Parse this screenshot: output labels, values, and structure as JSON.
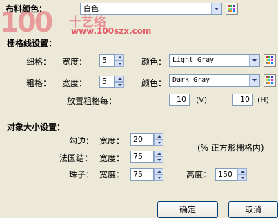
{
  "watermark": {
    "logo": "100",
    "cn": "十艺络",
    "url": "www.100szx.com"
  },
  "cloth_color": {
    "label": "布料颜色：",
    "value": "白色"
  },
  "grid": {
    "heading": "栅格线设置：",
    "fine": {
      "label": "细格：",
      "width_label": "宽度：",
      "width_value": "5",
      "color_label": "颜色：",
      "color_value": "Light Gray"
    },
    "coarse": {
      "label": "粗格：",
      "width_label": "宽度：",
      "width_value": "5",
      "color_label": "颜色：",
      "color_value": "Dark Gray"
    },
    "every": {
      "label": "放置粗格每：",
      "v_value": "10",
      "v_unit": "(V)",
      "h_value": "10",
      "h_unit": "(H)"
    }
  },
  "object_size": {
    "heading": "对象大小设置：",
    "outline": {
      "label": "勾边：",
      "width_label": "宽度：",
      "width_value": "20"
    },
    "french_knot": {
      "label": "法国结：",
      "width_label": "宽度：",
      "width_value": "75"
    },
    "bead": {
      "label": "珠子：",
      "width_label": "宽度：",
      "width_value": "75",
      "height_label": "高度：",
      "height_value": "150"
    },
    "note": "(% 正方形栅格内)"
  },
  "buttons": {
    "ok": "确定",
    "cancel": "取消"
  }
}
